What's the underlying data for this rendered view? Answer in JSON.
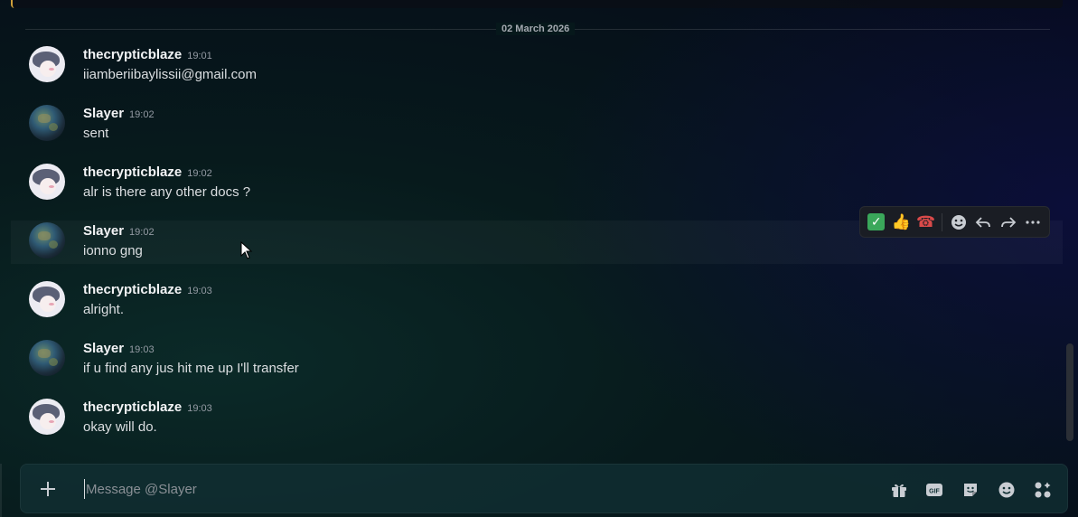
{
  "date_divider": "02 March 2026",
  "messages": [
    {
      "user": "thecrypticblaze",
      "time": "19:01",
      "text": "iiamberiibaylissii@gmail.com",
      "avatar": "anime-avatar"
    },
    {
      "user": "Slayer",
      "time": "19:02",
      "text": "sent",
      "avatar": "earth-avatar"
    },
    {
      "user": "thecrypticblaze",
      "time": "19:02",
      "text": "alr is there any other docs ?",
      "avatar": "anime-avatar"
    },
    {
      "user": "Slayer",
      "time": "19:02",
      "text": "ionno gng",
      "avatar": "earth-avatar"
    },
    {
      "user": "thecrypticblaze",
      "time": "19:03",
      "text": "alright.",
      "avatar": "anime-avatar"
    },
    {
      "user": "Slayer",
      "time": "19:03",
      "text": "if u find any jus hit me up I'll transfer",
      "avatar": "earth-avatar"
    },
    {
      "user": "thecrypticblaze",
      "time": "19:03",
      "text": "okay will do.",
      "avatar": "anime-avatar"
    }
  ],
  "hover_toolbar": {
    "reactions": [
      "white-check-mark",
      "thumbs-up",
      "telephone"
    ],
    "actions": [
      "add-reaction-icon",
      "reply-icon",
      "forward-icon",
      "more-icon"
    ]
  },
  "composer": {
    "placeholder": "Message @Slayer",
    "value": "",
    "icons": [
      "gift-icon",
      "gif-icon",
      "sticker-icon",
      "emoji-icon",
      "apps-icon"
    ]
  },
  "colors": {
    "accent_strip": "#d0a03a",
    "check_green": "#3aa75a"
  }
}
